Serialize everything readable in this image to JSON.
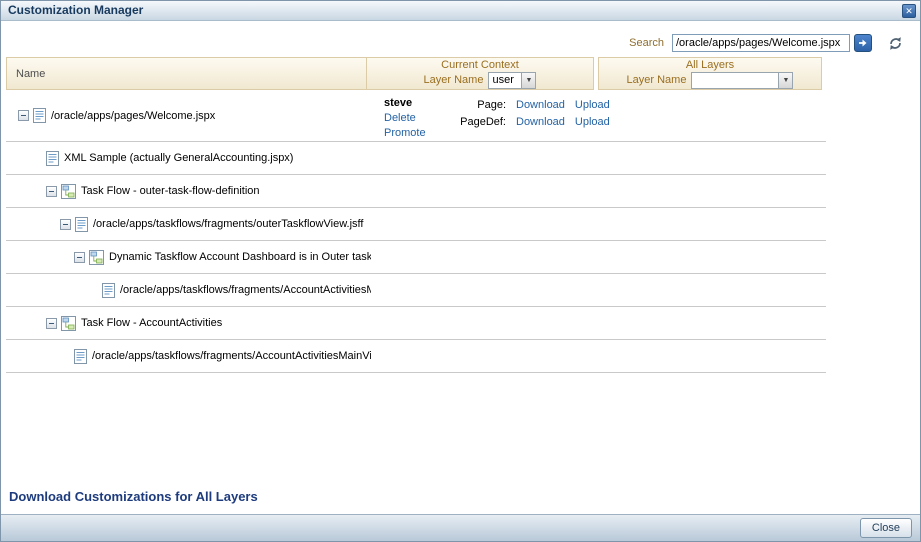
{
  "window": {
    "title": "Customization Manager"
  },
  "icons": {
    "close": "✕",
    "dropdown": "▼"
  },
  "search": {
    "label": "Search",
    "value": "/oracle/apps/pages/Welcome.jspx"
  },
  "header": {
    "name_column": "Name",
    "groups": [
      {
        "title": "Current Context",
        "layer_label": "Layer Name",
        "layer_value": "user"
      },
      {
        "title": "All Layers",
        "layer_label": "Layer Name",
        "layer_value": ""
      }
    ]
  },
  "tree": {
    "rows": [
      {
        "level": 0,
        "expandable": true,
        "icon": "document-icon",
        "label": "/oracle/apps/pages/Welcome.jspx",
        "context": {
          "layer_value": "steve",
          "actions": [
            "Delete",
            "Promote"
          ],
          "artifacts": [
            {
              "label": "Page:",
              "links": [
                "Download",
                "Upload"
              ]
            },
            {
              "label": "PageDef:",
              "links": [
                "Download",
                "Upload"
              ]
            }
          ]
        }
      },
      {
        "level": 2,
        "expandable": false,
        "icon": "document-icon",
        "label": "XML Sample (actually GeneralAccounting.jspx)"
      },
      {
        "level": 2,
        "expandable": true,
        "icon": "taskflow-icon",
        "label": "Task Flow - outer-task-flow-definition"
      },
      {
        "level": 3,
        "expandable": true,
        "icon": "document-icon",
        "label": "/oracle/apps/taskflows/fragments/outerTaskflowView.jsff"
      },
      {
        "level": 4,
        "expandable": true,
        "icon": "taskflow-icon",
        "label": "Dynamic Taskflow Account Dashboard is in Outer taskflow"
      },
      {
        "level": 6,
        "expandable": false,
        "icon": "document-icon",
        "label": "/oracle/apps/taskflows/fragments/AccountActivitiesM"
      },
      {
        "level": 2,
        "expandable": true,
        "icon": "taskflow-icon",
        "label": "Task Flow - AccountActivities"
      },
      {
        "level": 4,
        "expandable": false,
        "icon": "document-icon",
        "label": "/oracle/apps/taskflows/fragments/AccountActivitiesMainVie"
      }
    ]
  },
  "footer": {
    "download_all_link": "Download Customizations for All Layers",
    "close_button": "Close"
  }
}
